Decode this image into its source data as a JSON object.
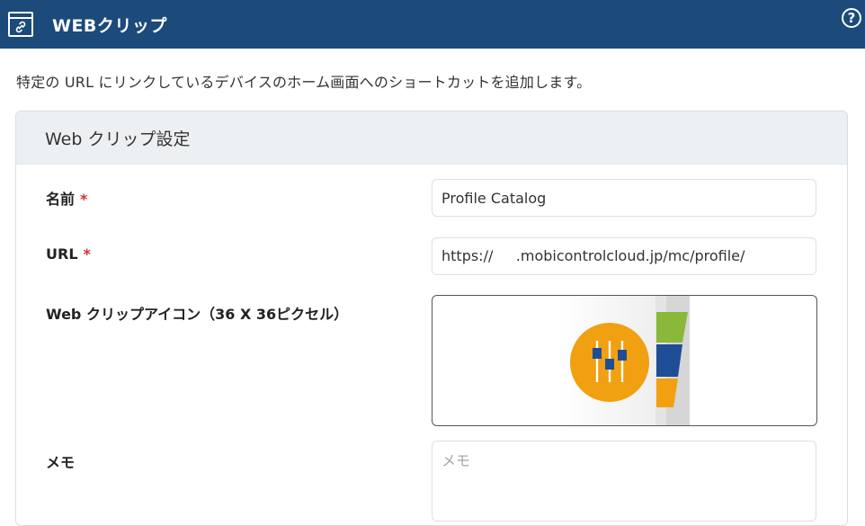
{
  "header": {
    "title": "WEBクリップ",
    "icon": "web-clip-link-icon",
    "help_icon": "help-icon",
    "help_glyph": "?",
    "background": "#1b4a7b"
  },
  "description": "特定の URL にリンクしているデバイスのホーム画面へのショートカットを追加します。",
  "panel": {
    "title": "Web クリップ設定",
    "fields": {
      "name": {
        "label": "名前",
        "required_mark": "*",
        "value": "Profile Catalog"
      },
      "url": {
        "label": "URL",
        "required_mark": "*",
        "value": "https://     .mobicontrolcloud.jp/mc/profile/"
      },
      "icon": {
        "label": "Web クリップアイコン（36 X 36ピクセル）",
        "image": "profile-catalog-app-icon"
      },
      "memo": {
        "label": "メモ",
        "placeholder": "メモ",
        "value": ""
      }
    }
  },
  "colors": {
    "accent_required": "#d0312d",
    "icon_orange": "#f0a010",
    "icon_blue": "#1f4e96",
    "icon_green": "#8ab83a"
  }
}
